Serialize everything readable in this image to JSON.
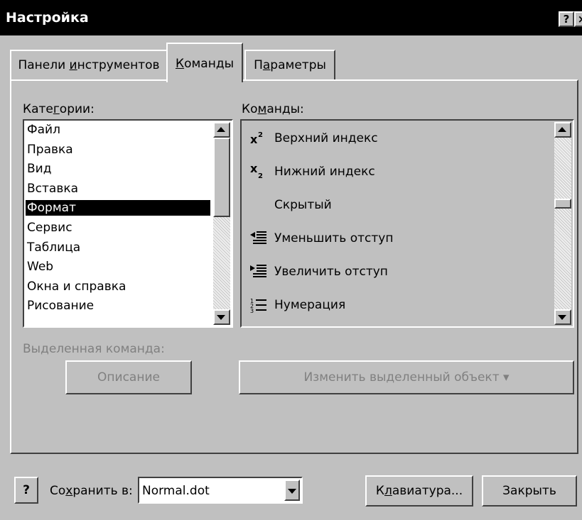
{
  "window": {
    "title": "Настройка",
    "help_button": "?",
    "close_button": "×"
  },
  "tabs": [
    {
      "label_pre": "Панели ",
      "label_u": "и",
      "label_post": "нструментов"
    },
    {
      "label_pre": "",
      "label_u": "К",
      "label_post": "оманды"
    },
    {
      "label_pre": "П",
      "label_u": "а",
      "label_post": "раметры"
    }
  ],
  "categories": {
    "label_pre": "Кате",
    "label_u": "г",
    "label_post": "ории:",
    "items": [
      "Файл",
      "Правка",
      "Вид",
      "Вставка",
      "Формат",
      "Сервис",
      "Таблица",
      "Web",
      "Окна и справка",
      "Рисование"
    ],
    "selected": "Формат"
  },
  "commands": {
    "label_pre": "Ко",
    "label_u": "м",
    "label_post": "анды:",
    "items": [
      {
        "label": "Верхний индекс",
        "icon": "superscript-icon"
      },
      {
        "label": "Нижний индекс",
        "icon": "subscript-icon"
      },
      {
        "label": "Скрытый",
        "icon": "none"
      },
      {
        "label": "Уменьшить отступ",
        "icon": "decrease-indent-icon"
      },
      {
        "label": "Увеличить отступ",
        "icon": "increase-indent-icon"
      },
      {
        "label": "Нумерация",
        "icon": "numbering-icon"
      }
    ]
  },
  "selected_command": {
    "label": "Выделенная команда:",
    "describe_button": "Описание",
    "modify_button": "Изменить выделенный объект ▾"
  },
  "footer": {
    "help_icon": "?",
    "save_in_pre": "Со",
    "save_in_u": "х",
    "save_in_post": "ранить в:",
    "save_in_value": "Normal.dot",
    "keyboard_pre": "К",
    "keyboard_u": "л",
    "keyboard_post": "авиатура...",
    "close_button": "Закрыть"
  },
  "colors": {
    "titlebar": "#000000",
    "dialog": "#c0c0c0",
    "selection": "#000000",
    "disabled_text": "#808080"
  }
}
